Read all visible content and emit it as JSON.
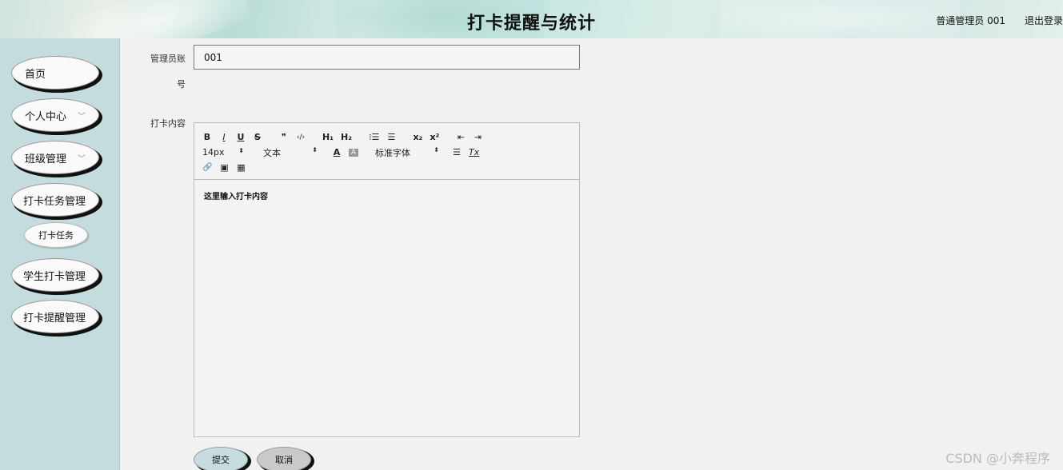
{
  "header": {
    "title": "打卡提醒与统计",
    "user": "普通管理员 001",
    "logout": "退出登录"
  },
  "sidebar": {
    "items": [
      {
        "label": "首页"
      },
      {
        "label": "个人中心",
        "chevron": "﹀"
      },
      {
        "label": "班级管理",
        "chevron": "﹀"
      },
      {
        "label": "打卡任务管理"
      },
      {
        "label": "打卡任务"
      },
      {
        "label": "学生打卡管理"
      },
      {
        "label": "打卡提醒管理"
      }
    ]
  },
  "form": {
    "account_label_line1": "管理员账",
    "account_label_line2": "号",
    "account_value": "001",
    "content_label": "打卡内容",
    "editor_placeholder": "这里输入打卡内容",
    "toolbar": {
      "bold": "B",
      "italic": "I",
      "underline": "U",
      "strike": "S",
      "quote": "❞",
      "code": "‹/›",
      "h1": "H₁",
      "h2": "H₂",
      "ordered": "⁝☰",
      "bullet": "☰",
      "sub": "x₂",
      "sup": "x²",
      "outdent": "⇤",
      "indent": "⇥",
      "size": "14px",
      "type": "文本",
      "font": "标准字体",
      "color": "A",
      "background": "A",
      "align": "☰",
      "clean": "Tx",
      "link": "🔗",
      "image": "▣",
      "video": "▦",
      "arrow": "⬍"
    },
    "submit": "提交",
    "cancel": "取消"
  },
  "watermark": "CSDN @小奔程序"
}
